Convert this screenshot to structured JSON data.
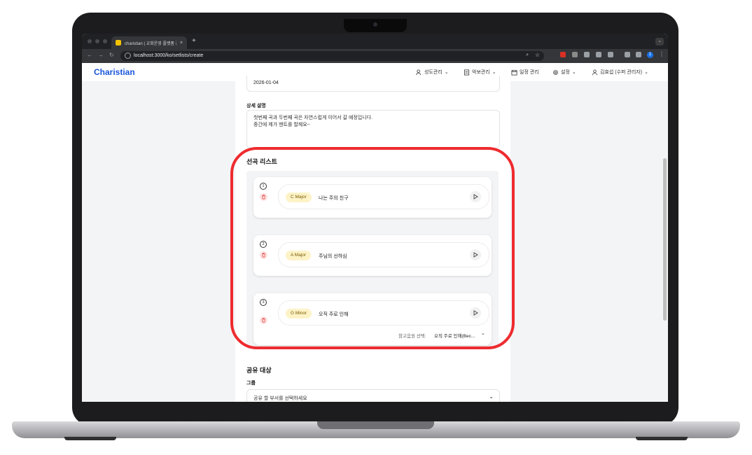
{
  "browser": {
    "tab_title": "charistian | 교회운영 플랫폼 플랫",
    "tab_close": "×",
    "new_tab": "+",
    "url": "localhost:3000/ko/setlists/create",
    "profile_initial": "1"
  },
  "app": {
    "brand": "Charistian",
    "nav": [
      {
        "label": "성도관리",
        "icon": "users-icon",
        "caret": "⌄"
      },
      {
        "label": "악보관리",
        "icon": "sheet-icon",
        "caret": "⌄"
      },
      {
        "label": "일정 관리",
        "icon": "calendar-icon"
      },
      {
        "label": "설정",
        "icon": "gear-icon",
        "caret": "⌄"
      },
      {
        "label": "김효섭 (수퍼 관리자)",
        "icon": "user-icon",
        "caret": "⌄"
      }
    ]
  },
  "form": {
    "date_value": "2026-01-04",
    "description_label": "상세 설명",
    "description_lines": [
      "첫번째 곡과 두번째 곡은 자연스럽게 이어서 갈 예정입니다.",
      "중간에 제가 멘트를 할께요~"
    ],
    "songs_title": "선곡 리스트",
    "songs": [
      {
        "number": "1",
        "key": "C Major",
        "title": "나는 주의 친구"
      },
      {
        "number": "2",
        "key": "A Major",
        "title": "주님의 선하심"
      },
      {
        "number": "3",
        "key": "G Minor",
        "title": "오직 주로 인해",
        "reference_label": "참고음원 선택:",
        "reference_value": "오직 주로 인해(Bec..."
      }
    ],
    "share_title": "공유 대상",
    "group_label": "그룹",
    "group_placeholder": "공유 할 부서를 선택하세요"
  },
  "colors": {
    "brand": "#1a56db",
    "highlight": "#ee2b2f",
    "key_badge": "#fdf3c7",
    "trash_bg": "#fde2e2"
  }
}
